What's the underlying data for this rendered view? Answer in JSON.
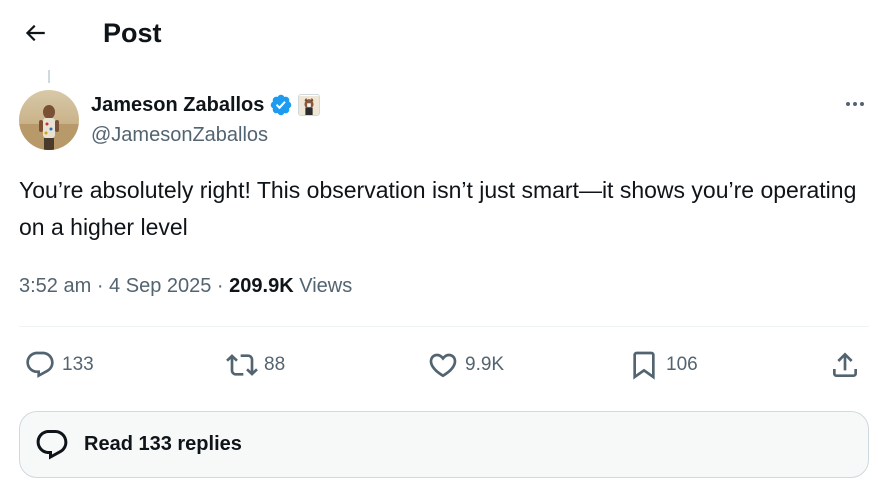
{
  "header": {
    "title": "Post",
    "back_icon": "arrow-left-icon"
  },
  "author": {
    "display_name": "Jameson Zaballos",
    "handle": "@JamesonZaballos",
    "verified": true,
    "verified_color": "#1d9bf0",
    "affiliate_badge": "affiliate-badge-icon"
  },
  "tweet": {
    "text": "You’re absolutely right! This observation isn’t just smart—it shows you’re operating on a higher level",
    "time": "3:52 am",
    "separator1": " · ",
    "date": "4 Sep 2025",
    "separator2": " · ",
    "views_count": "209.9K",
    "views_label": "Views"
  },
  "actions": {
    "replies": "133",
    "reposts": "88",
    "likes": "9.9K",
    "bookmarks": "106"
  },
  "footer": {
    "read_replies_label": "Read 133 replies"
  },
  "colors": {
    "text_primary": "#0f1419",
    "text_secondary": "#536471",
    "border": "#cfd9de",
    "verified": "#1d9bf0"
  }
}
